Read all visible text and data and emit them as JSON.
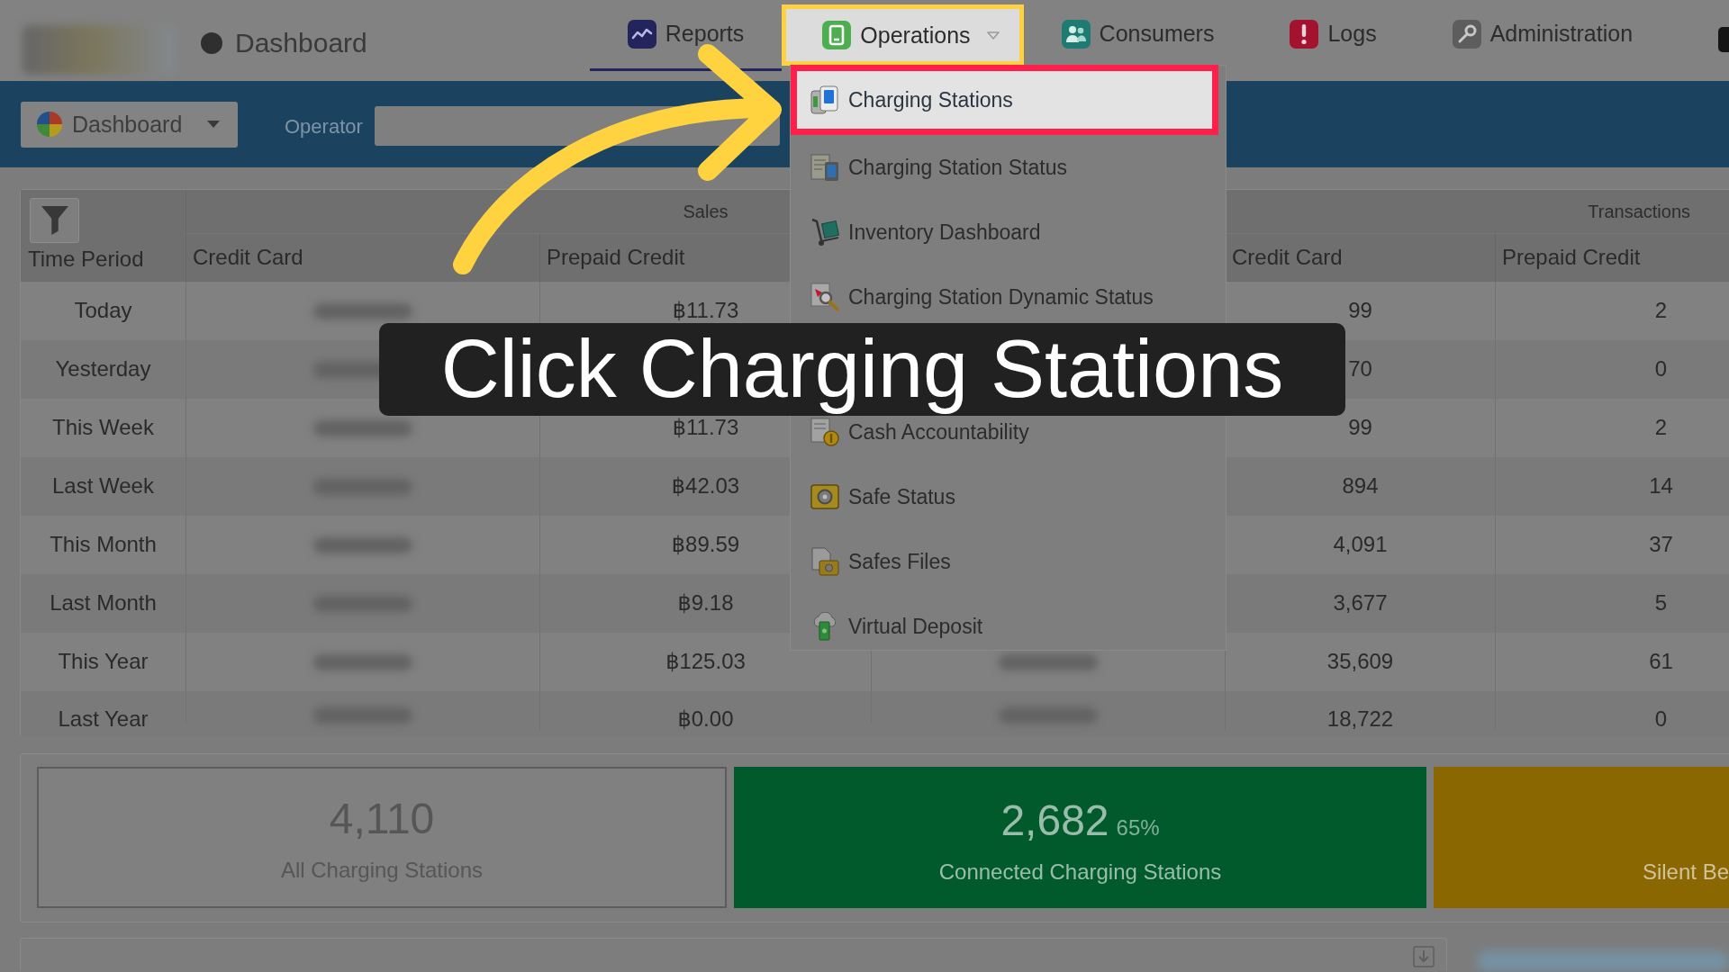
{
  "header": {
    "home": {
      "label": "Dashboard"
    },
    "tabs": [
      {
        "label": "Reports",
        "selected": true,
        "highlighted": false,
        "dropdown": false
      },
      {
        "label": "Operations",
        "selected": false,
        "highlighted": true,
        "dropdown": true
      },
      {
        "label": "Consumers",
        "selected": false,
        "highlighted": false,
        "dropdown": false
      },
      {
        "label": "Logs",
        "selected": false,
        "highlighted": false,
        "dropdown": false
      },
      {
        "label": "Administration",
        "selected": false,
        "highlighted": false,
        "dropdown": false
      }
    ]
  },
  "toolbar": {
    "view_button": "Dashboard",
    "operator": {
      "label": "Operator"
    }
  },
  "table": {
    "column_groups": [
      {
        "label": "Sales"
      },
      {
        "label": "Transactions"
      }
    ],
    "columns": [
      {
        "kind": "label",
        "label": "Time Period"
      },
      {
        "kind": "label",
        "label": "Credit Card"
      },
      {
        "kind": "label",
        "label": "Prepaid Credit"
      },
      {
        "kind": "covered"
      },
      {
        "kind": "label",
        "label": "Credit Card"
      },
      {
        "kind": "label",
        "label": "Prepaid Credit"
      }
    ],
    "rows": [
      {
        "time_period": "Today",
        "sales_prepaid_credit": "฿11.73",
        "transactions_credit_card": "99",
        "transactions_prepaid_credit": "2"
      },
      {
        "time_period": "Yesterday",
        "transactions_credit_card": "70",
        "transactions_prepaid_credit": "0"
      },
      {
        "time_period": "This Week",
        "sales_prepaid_credit": "฿11.73",
        "transactions_credit_card": "99",
        "transactions_prepaid_credit": "2"
      },
      {
        "time_period": "Last Week",
        "sales_prepaid_credit": "฿42.03",
        "transactions_credit_card": "894",
        "transactions_prepaid_credit": "14"
      },
      {
        "time_period": "This Month",
        "sales_prepaid_credit": "฿89.59",
        "transactions_credit_card": "4,091",
        "transactions_prepaid_credit": "37"
      },
      {
        "time_period": "Last Month",
        "sales_prepaid_credit": "฿9.18",
        "transactions_credit_card": "3,677",
        "transactions_prepaid_credit": "5"
      },
      {
        "time_period": "This Year",
        "sales_prepaid_credit": "฿125.03",
        "transactions_credit_card": "35,609",
        "transactions_prepaid_credit": "61"
      },
      {
        "time_period": "Last Year",
        "sales_prepaid_credit": "฿0.00",
        "transactions_credit_card": "18,722",
        "transactions_prepaid_credit": "0"
      }
    ]
  },
  "operations_menu": {
    "items": [
      {
        "kind": "entry",
        "label": "Charging Stations",
        "highlighted": true
      },
      {
        "kind": "entry",
        "label": "Charging Station Status",
        "highlighted": false
      },
      {
        "kind": "entry",
        "label": "Inventory Dashboard",
        "highlighted": false
      },
      {
        "kind": "entry",
        "label": "Charging Station Dynamic Status",
        "highlighted": false
      },
      {
        "kind": "covered"
      },
      {
        "kind": "entry",
        "label": "Cash Accountability",
        "highlighted": false
      },
      {
        "kind": "entry",
        "label": "Safe Status",
        "highlighted": false
      },
      {
        "kind": "entry",
        "label": "Safes Files",
        "highlighted": false
      },
      {
        "kind": "entry",
        "label": "Virtual Deposit",
        "highlighted": false
      }
    ]
  },
  "overlay_caption": {
    "text": "Click Charging Stations"
  },
  "stats": {
    "cards": [
      {
        "kind": "outline",
        "value": "4,110",
        "label": "All Charging Stations"
      },
      {
        "kind": "filled",
        "color": "#015a2b",
        "value": "2,682",
        "percent": "65%",
        "label": "Connected Charging Stations"
      },
      {
        "kind": "filled",
        "color": "#8a6700",
        "label": "Silent Be"
      }
    ]
  }
}
